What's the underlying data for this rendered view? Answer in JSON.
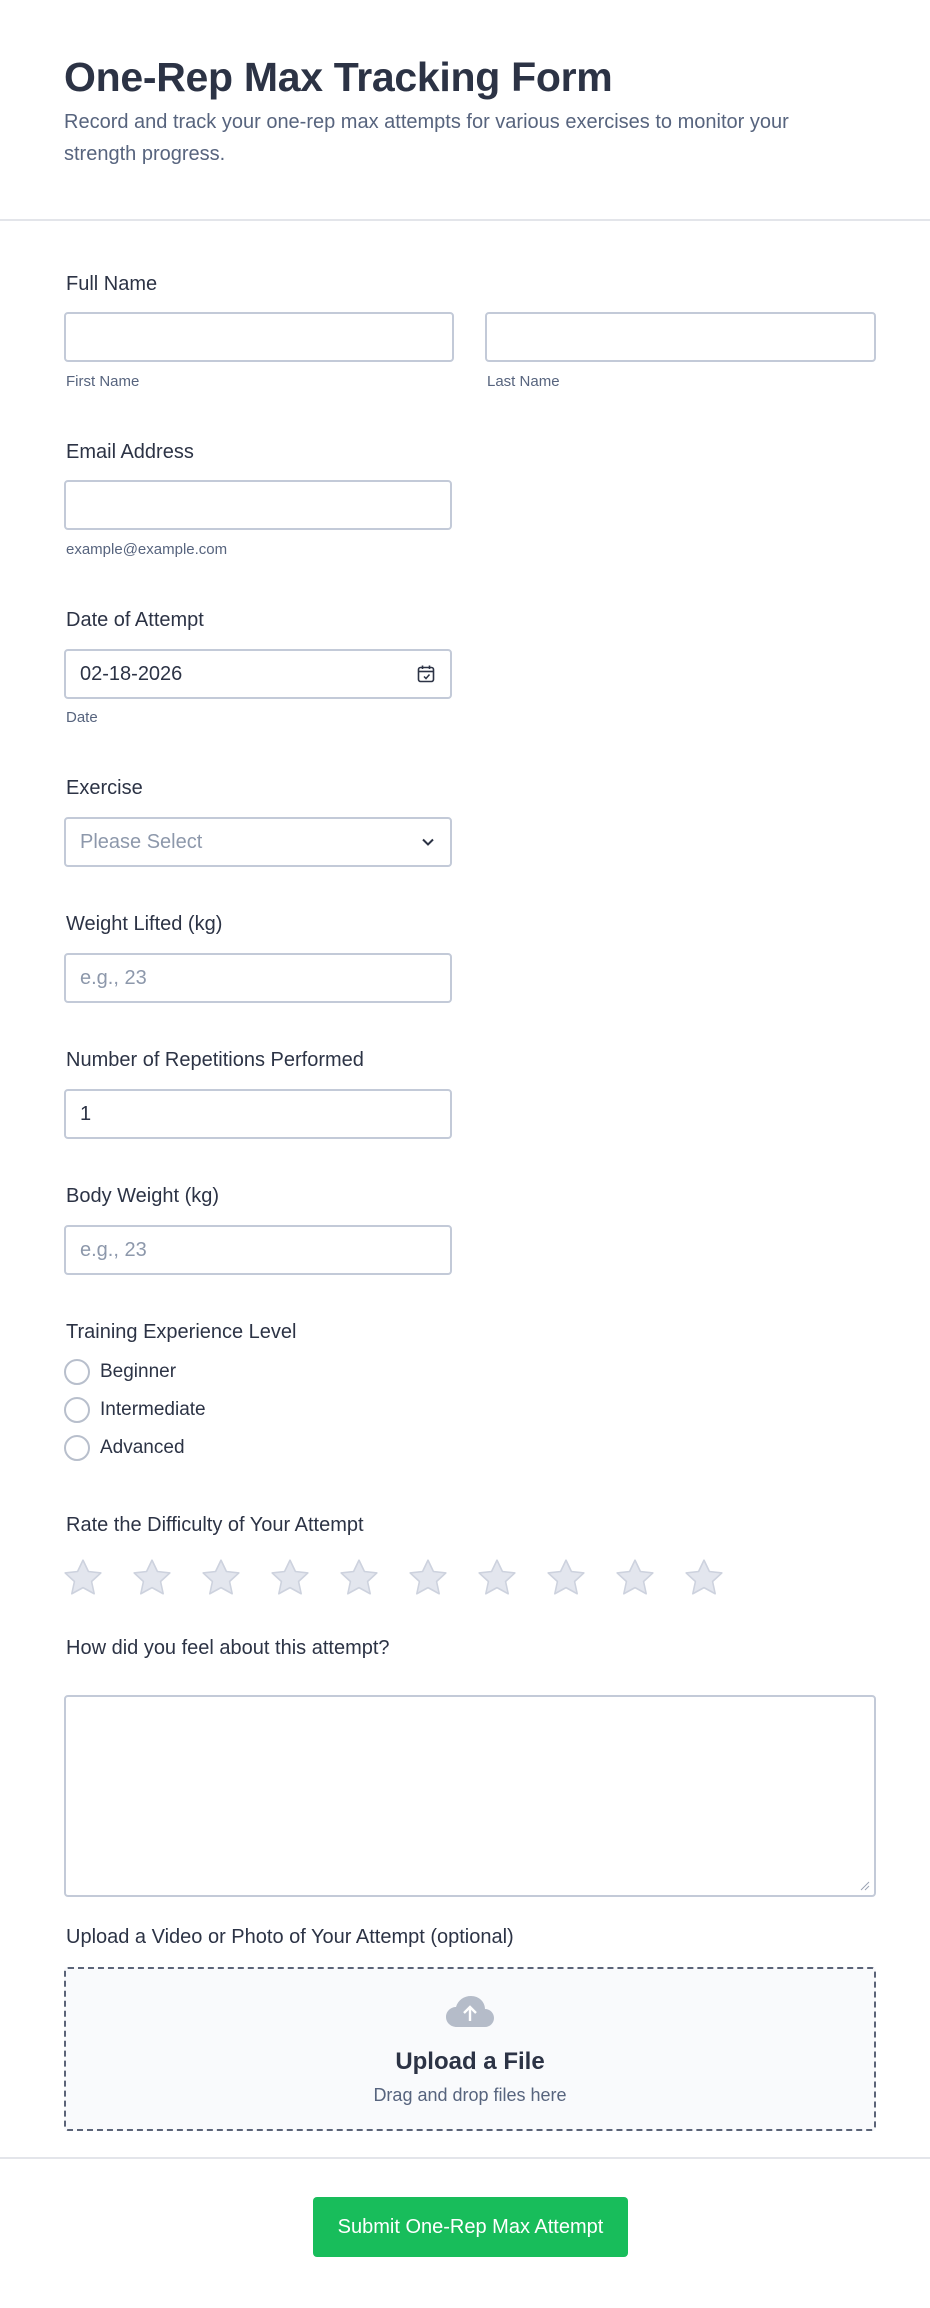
{
  "header": {
    "title": "One-Rep Max Tracking Form",
    "subtitle": "Record and track your one-rep max attempts for various exercises to monitor your strength progress."
  },
  "full_name": {
    "label": "Full Name",
    "first_sublabel": "First Name",
    "last_sublabel": "Last Name",
    "first_value": "",
    "last_value": ""
  },
  "email": {
    "label": "Email Address",
    "sublabel": "example@example.com",
    "value": ""
  },
  "date": {
    "label": "Date of Attempt",
    "value": "02-18-2026",
    "sublabel": "Date",
    "icon": "calendar-icon"
  },
  "exercise": {
    "label": "Exercise",
    "placeholder": "Please Select",
    "icon": "chevron-down-icon"
  },
  "weight": {
    "label": "Weight Lifted (kg)",
    "placeholder": "e.g., 23"
  },
  "reps": {
    "label": "Number of Repetitions Performed",
    "value": "1"
  },
  "body_weight": {
    "label": "Body Weight (kg)",
    "placeholder": "e.g., 23"
  },
  "experience": {
    "label": "Training Experience Level",
    "options": [
      "Beginner",
      "Intermediate",
      "Advanced"
    ]
  },
  "difficulty": {
    "label": "Rate the Difficulty of Your Attempt",
    "max_stars": 10,
    "selected": 0,
    "star_color": "#e3e6ee",
    "star_outline": "#cdd2de"
  },
  "feeling": {
    "label": "How did you feel about this attempt?"
  },
  "upload": {
    "label": "Upload a Video or Photo of Your Attempt (optional)",
    "title": "Upload a File",
    "hint": "Drag and drop files here",
    "icon": "cloud-upload-icon"
  },
  "submit": {
    "label": "Submit One-Rep Max Attempt",
    "color": "#18bd5b"
  }
}
